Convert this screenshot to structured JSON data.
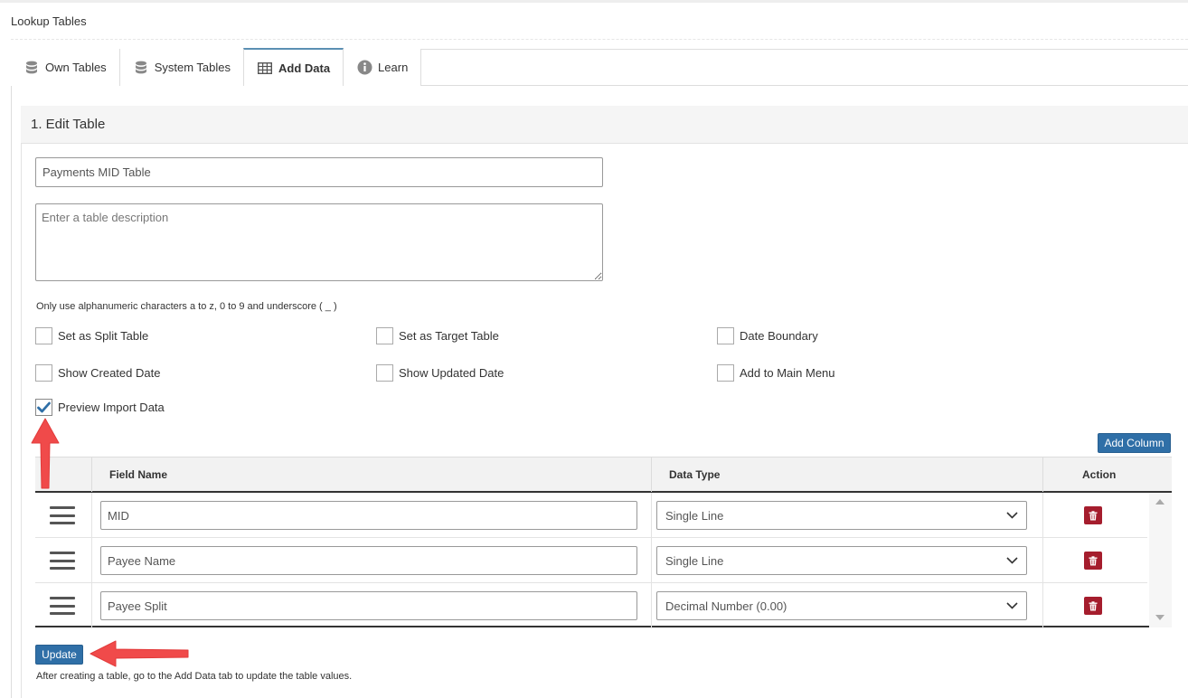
{
  "page": {
    "title": "Lookup Tables"
  },
  "tabs": [
    {
      "label": "Own Tables",
      "icon": "database-icon",
      "active": false
    },
    {
      "label": "System Tables",
      "icon": "database-icon",
      "active": false
    },
    {
      "label": "Add Data",
      "icon": "table-grid-icon",
      "active": true
    },
    {
      "label": "Learn",
      "icon": "info-circle-icon",
      "active": false
    }
  ],
  "section": {
    "title": "1. Edit Table"
  },
  "form": {
    "table_name": "Payments MID Table",
    "description_placeholder": "Enter a table description",
    "hint": "Only use alphanumeric characters a to z, 0 to 9 and underscore ( _ )"
  },
  "options": {
    "split_table": {
      "label": "Set as Split Table",
      "checked": false
    },
    "target_table": {
      "label": "Set as Target Table",
      "checked": false
    },
    "date_boundary": {
      "label": "Date Boundary",
      "checked": false
    },
    "created_date": {
      "label": "Show Created Date",
      "checked": false
    },
    "updated_date": {
      "label": "Show Updated Date",
      "checked": false
    },
    "main_menu": {
      "label": "Add to Main Menu",
      "checked": false
    },
    "preview_import": {
      "label": "Preview Import Data",
      "checked": true
    }
  },
  "columns": {
    "add_label": "Add Column",
    "headers": {
      "field_name": "Field Name",
      "data_type": "Data Type",
      "action": "Action"
    },
    "rows": [
      {
        "field_name": "MID",
        "data_type": "Single Line"
      },
      {
        "field_name": "Payee Name",
        "data_type": "Single Line"
      },
      {
        "field_name": "Payee Split",
        "data_type": "Decimal Number (0.00)"
      }
    ]
  },
  "update_label": "Update",
  "footnote": "After creating a table, go to the Add Data tab to update the table values.",
  "colors": {
    "primary": "#2f6fa7",
    "danger": "#a51d2d",
    "annotation": "#f04a4a"
  }
}
